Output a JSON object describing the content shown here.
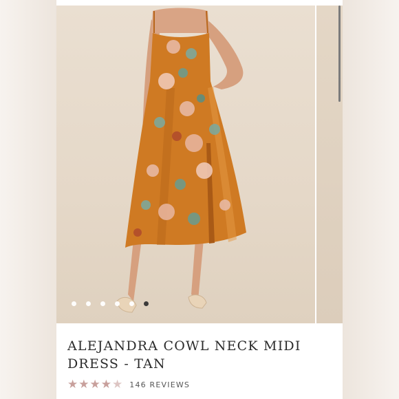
{
  "product": {
    "title": "ALEJANDRA COWL NECK MIDI DRESS - TAN",
    "rating_stars": 4.5,
    "reviews_label": "146 REVIEWS"
  },
  "gallery": {
    "image_count": 6,
    "active_index": 5,
    "subject": "dress-photo"
  },
  "colors": {
    "dress": "#cf7a23",
    "background": "#e8dccd",
    "star": "#c8a09c",
    "active_dot": "#333333"
  }
}
